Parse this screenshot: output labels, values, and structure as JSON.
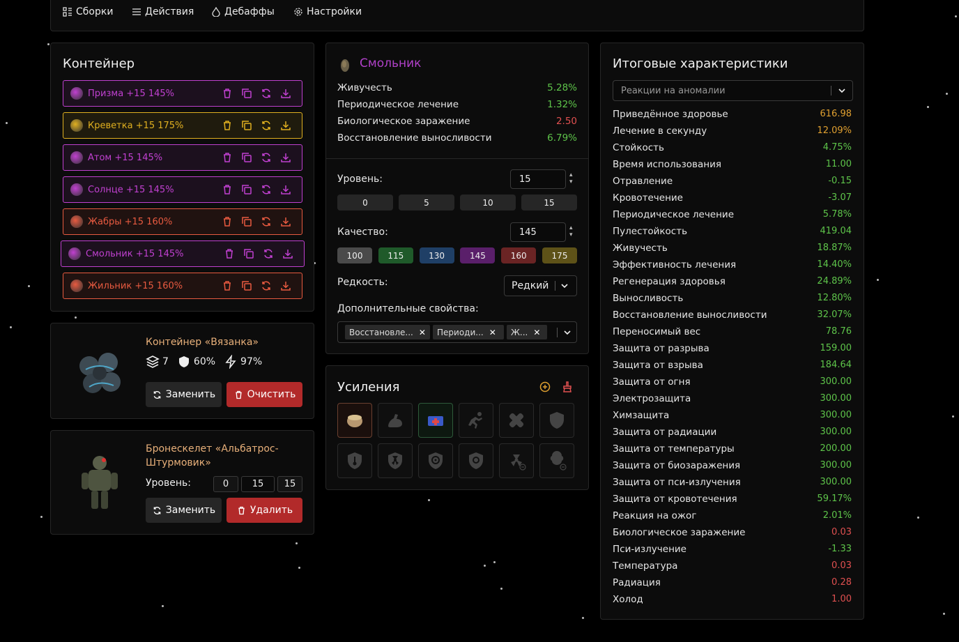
{
  "nav": [
    {
      "label": "Сборки",
      "icon": "grid-icon"
    },
    {
      "label": "Действия",
      "icon": "menu-icon"
    },
    {
      "label": "Дебаффы",
      "icon": "drop-icon"
    },
    {
      "label": "Настройки",
      "icon": "gear-icon"
    }
  ],
  "container": {
    "title": "Контейнер",
    "artifacts": [
      {
        "label": "Призма +15 145%",
        "color": "#c040d0"
      },
      {
        "label": "Креветка +15 175%",
        "color": "#e0b020"
      },
      {
        "label": "Атом +15 145%",
        "color": "#c040d0"
      },
      {
        "label": "Солнце +15 145%",
        "color": "#c040d0"
      },
      {
        "label": "Жабры +15 160%",
        "color": "#e85a40"
      },
      {
        "label": "Смольник +15 145%",
        "color": "#c040d0"
      },
      {
        "label": "Жильник +15 160%",
        "color": "#e85a40"
      }
    ]
  },
  "equip1": {
    "name": "Контейнер «Вязанка»",
    "slots": "7",
    "protection": "60%",
    "efficiency": "97%",
    "replace_label": "Заменить",
    "clear_label": "Очистить"
  },
  "equip2": {
    "name_line1": "Бронескелет «Альбатрос-",
    "name_line2": "Штурмовик»",
    "level_label": "Уровень:",
    "levels": [
      "0",
      "15",
      "15"
    ],
    "replace_label": "Заменить",
    "delete_label": "Удалить"
  },
  "detail": {
    "name": "Смольник",
    "stats": [
      {
        "name": "Живучесть",
        "value": "5.28%",
        "color": "#5ec44a"
      },
      {
        "name": "Периодическое лечение",
        "value": "1.32%",
        "color": "#5ec44a"
      },
      {
        "name": "Биологическое заражение",
        "value": "2.50",
        "color": "#e05050"
      },
      {
        "name": "Восстановление выносливости",
        "value": "6.79%",
        "color": "#5ec44a"
      }
    ],
    "level_label": "Уровень:",
    "level_value": "15",
    "level_chips": [
      "0",
      "5",
      "10",
      "15"
    ],
    "quality_label": "Качество:",
    "quality_value": "145",
    "quality_chips": [
      {
        "label": "100",
        "color": "#4a4a4a"
      },
      {
        "label": "115",
        "color": "#1f5a2a"
      },
      {
        "label": "130",
        "color": "#1f3f66"
      },
      {
        "label": "145",
        "color": "#5a1f6a"
      },
      {
        "label": "160",
        "color": "#6a2424"
      },
      {
        "label": "175",
        "color": "#5e5218"
      }
    ],
    "rarity_label": "Редкость:",
    "rarity_value": "Редкий",
    "extra_label": "Дополнительные свойства:",
    "extra_tags": [
      "Восстановле...",
      "Периоди...",
      "Ж..."
    ]
  },
  "boosts": {
    "title": "Усиления"
  },
  "totals": {
    "title": "Итоговые характеристики",
    "select_placeholder": "Реакции на аномалии",
    "rows": [
      {
        "name": "Приведённое здоровье",
        "value": "616.98",
        "color": "#e0a030"
      },
      {
        "name": "Лечение в секунду",
        "value": "12.09%",
        "color": "#e0a030"
      },
      {
        "name": "Стойкость",
        "value": "4.75%",
        "color": "#5ec44a"
      },
      {
        "name": "Время использования",
        "value": "11.00",
        "color": "#5ec44a"
      },
      {
        "name": "Отравление",
        "value": "-0.15",
        "color": "#5ec44a"
      },
      {
        "name": "Кровотечение",
        "value": "-3.07",
        "color": "#5ec44a"
      },
      {
        "name": "Периодическое лечение",
        "value": "5.78%",
        "color": "#5ec44a"
      },
      {
        "name": "Пулестойкость",
        "value": "419.04",
        "color": "#5ec44a"
      },
      {
        "name": "Живучесть",
        "value": "18.87%",
        "color": "#5ec44a"
      },
      {
        "name": "Эффективность лечения",
        "value": "14.40%",
        "color": "#5ec44a"
      },
      {
        "name": "Регенерация здоровья",
        "value": "24.89%",
        "color": "#5ec44a"
      },
      {
        "name": "Выносливость",
        "value": "12.80%",
        "color": "#5ec44a"
      },
      {
        "name": "Восстановление выносливости",
        "value": "32.07%",
        "color": "#5ec44a"
      },
      {
        "name": "Переносимый вес",
        "value": "78.76",
        "color": "#5ec44a"
      },
      {
        "name": "Защита от разрыва",
        "value": "159.00",
        "color": "#5ec44a"
      },
      {
        "name": "Защита от взрыва",
        "value": "184.64",
        "color": "#5ec44a"
      },
      {
        "name": "Защита от огня",
        "value": "300.00",
        "color": "#5ec44a"
      },
      {
        "name": "Электрозащита",
        "value": "300.00",
        "color": "#5ec44a"
      },
      {
        "name": "Химзащита",
        "value": "300.00",
        "color": "#5ec44a"
      },
      {
        "name": "Защита от радиации",
        "value": "300.00",
        "color": "#5ec44a"
      },
      {
        "name": "Защита от температуры",
        "value": "200.00",
        "color": "#5ec44a"
      },
      {
        "name": "Защита от биозаражения",
        "value": "300.00",
        "color": "#5ec44a"
      },
      {
        "name": "Защита от пси-излучения",
        "value": "300.00",
        "color": "#5ec44a"
      },
      {
        "name": "Защита от кровотечения",
        "value": "59.17%",
        "color": "#5ec44a"
      },
      {
        "name": "Реакция на ожог",
        "value": "2.01%",
        "color": "#5ec44a"
      },
      {
        "name": "Биологическое заражение",
        "value": "0.03",
        "color": "#e05050"
      },
      {
        "name": "Пси-излучение",
        "value": "-1.33",
        "color": "#5ec44a"
      },
      {
        "name": "Температура",
        "value": "0.03",
        "color": "#e05050"
      },
      {
        "name": "Радиация",
        "value": "0.28",
        "color": "#e05050"
      },
      {
        "name": "Холод",
        "value": "1.00",
        "color": "#e05050"
      }
    ]
  }
}
